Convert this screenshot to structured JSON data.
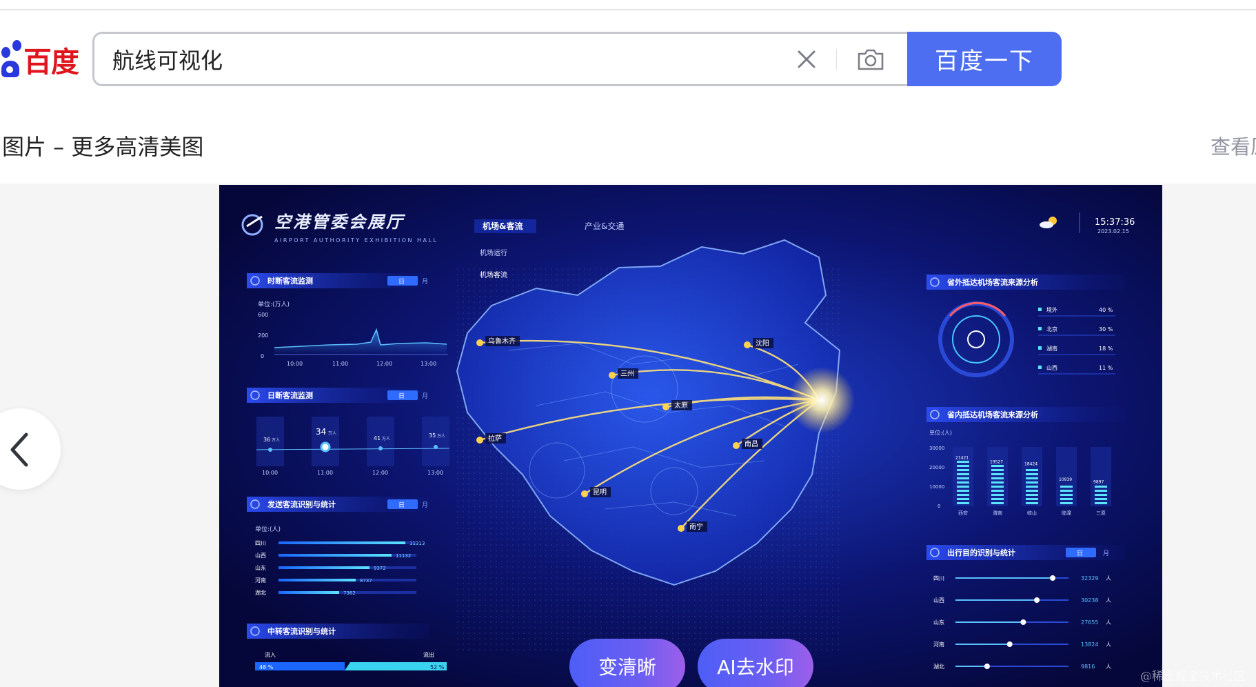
{
  "brand": {
    "logo_text": "百度"
  },
  "search": {
    "query": "航线可视化",
    "submit_label": "百度一下"
  },
  "section": {
    "title": "图片 – 更多高清美图",
    "view_link": "查看原"
  },
  "icons": {
    "clear": "close-icon",
    "camera": "camera-icon",
    "prev": "chevron-left-icon"
  },
  "actions": {
    "sharpen_label": "变清晰",
    "remove_watermark_label": "AI去水印"
  },
  "watermark": "@稀土掘金技术社区",
  "dashboard": {
    "title": "空港管委会展厅",
    "subtitle": "AIRPORT AUTHORITY EXHIBITION HALL",
    "nav": [
      "机场&客流",
      "产业&交通"
    ],
    "subnav": [
      "机场运行",
      "机场客流"
    ],
    "clock": {
      "time": "15:37:36",
      "date": "2023.02.15"
    },
    "toggle": {
      "day": "日",
      "month": "月"
    },
    "left_panels": {
      "realtime": {
        "title": "时断客流监测",
        "unit": "单位:(万人)",
        "y_ticks": [
          "600",
          "200",
          "0"
        ],
        "x_ticks": [
          "10:00",
          "11:00",
          "12:00",
          "13:00"
        ]
      },
      "daily": {
        "title": "日断客流监测",
        "points": [
          {
            "value": "36",
            "unit": "万人",
            "time": "10:00"
          },
          {
            "value": "34",
            "unit": "万人",
            "time": "11:00"
          },
          {
            "value": "41",
            "unit": "万人",
            "time": "12:00"
          },
          {
            "value": "35",
            "unit": "万人",
            "time": "13:00"
          }
        ]
      },
      "outbound": {
        "title": "发送客流识别与统计",
        "unit": "单位:(人)",
        "rows": [
          {
            "name": "四川",
            "value": "11313",
            "fill": 0.92
          },
          {
            "name": "山西",
            "value": "11132",
            "fill": 0.82
          },
          {
            "name": "山东",
            "value": "9372",
            "fill": 0.66
          },
          {
            "name": "河南",
            "value": "8737",
            "fill": 0.56
          },
          {
            "name": "湖北",
            "value": "7362",
            "fill": 0.44
          }
        ]
      },
      "transfer": {
        "title": "中转客流识别与统计",
        "in_label": "流入",
        "out_label": "流出",
        "in_pct": "48 %",
        "out_pct": "52 %"
      }
    },
    "right_panels": {
      "external": {
        "title": "省外抵达机场客流来源分析",
        "rows": [
          {
            "name": "境外",
            "pct": "40 %"
          },
          {
            "name": "北京",
            "pct": "30 %"
          },
          {
            "name": "湖南",
            "pct": "18 %"
          },
          {
            "name": "山西",
            "pct": "11 %"
          }
        ]
      },
      "internal": {
        "title": "省内抵达机场客流来源分析",
        "unit": "单位:(人)",
        "y_ticks": [
          "30000",
          "20000",
          "10000",
          "0"
        ],
        "bars": [
          {
            "name": "西安",
            "value": "21421"
          },
          {
            "name": "渭南",
            "value": "19527"
          },
          {
            "name": "岐山",
            "value": "18424"
          },
          {
            "name": "临潼",
            "value": "10939"
          },
          {
            "name": "三原",
            "value": "9897"
          }
        ]
      },
      "destination": {
        "title": "出行目的识别与统计",
        "rows": [
          {
            "name": "四川",
            "value": "32329",
            "unit": "人",
            "fill": 0.86
          },
          {
            "name": "山西",
            "value": "30238",
            "unit": "人",
            "fill": 0.72
          },
          {
            "name": "山东",
            "value": "27655",
            "unit": "人",
            "fill": 0.6
          },
          {
            "name": "河南",
            "value": "13824",
            "unit": "人",
            "fill": 0.48
          },
          {
            "name": "湖北",
            "value": "9816",
            "unit": "人",
            "fill": 0.28
          }
        ]
      }
    },
    "cities": [
      "乌鲁木齐",
      "三州",
      "太原",
      "沈阳",
      "拉萨",
      "南昌",
      "昆明",
      "南宁"
    ]
  }
}
